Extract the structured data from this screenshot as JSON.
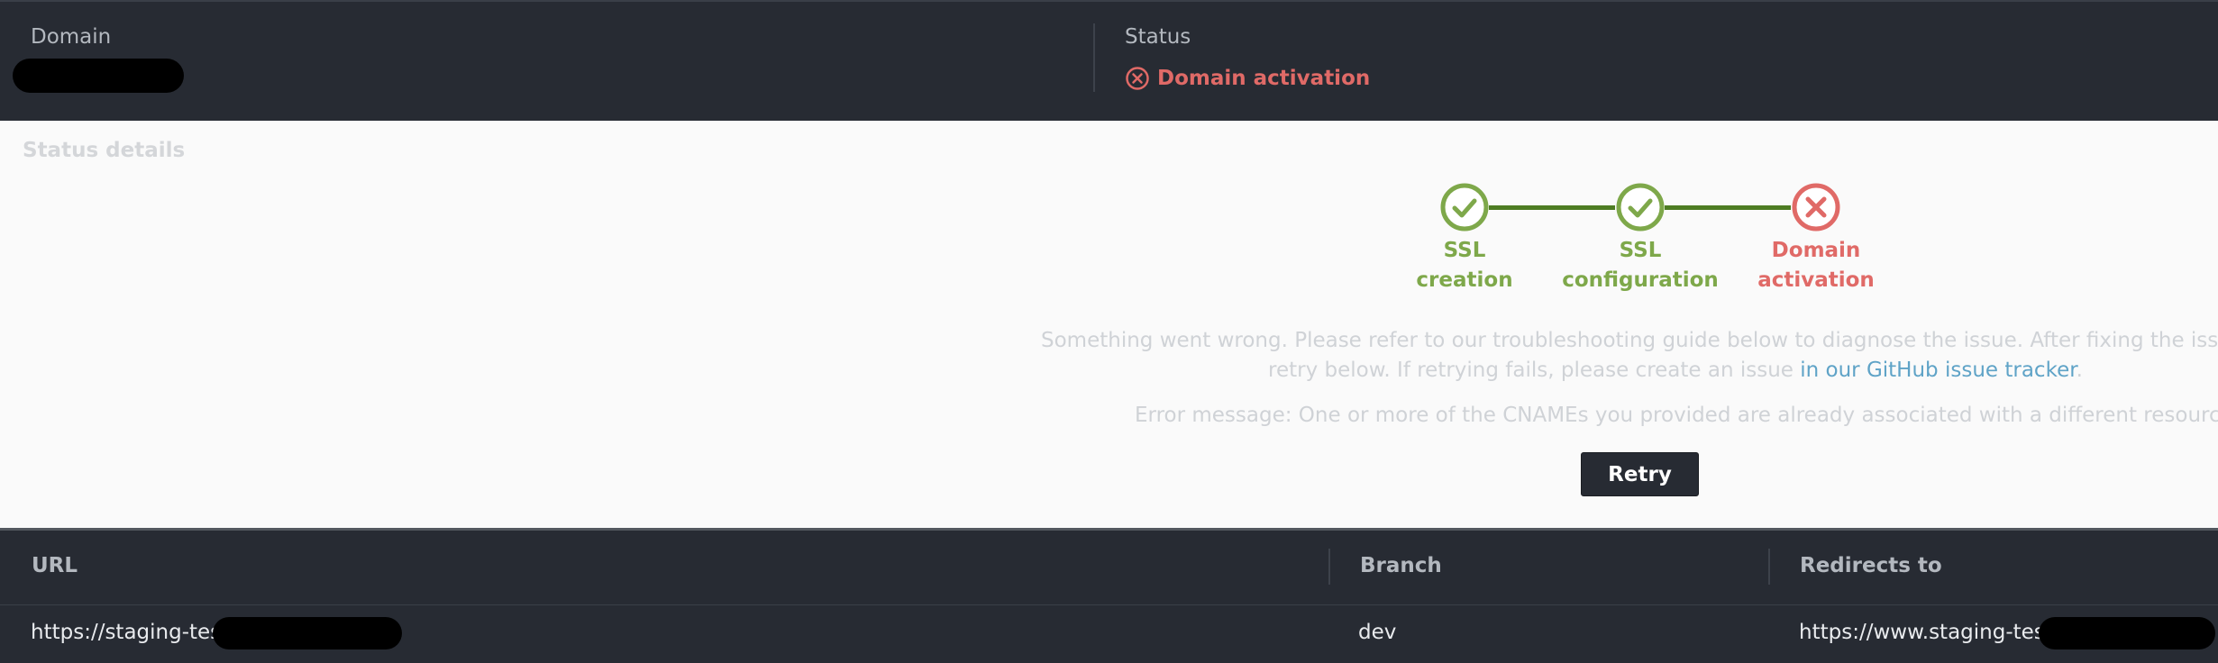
{
  "header": {
    "domain_label": "Domain",
    "status_label": "Status",
    "status_value": "Domain activation",
    "status_icon": "error-circle-icon",
    "status_color": "#e06a67"
  },
  "details": {
    "title": "Status details",
    "steps": [
      {
        "label_line1": "SSL",
        "label_line2": "creation",
        "state": "complete",
        "icon": "check-circle-icon"
      },
      {
        "label_line1": "SSL",
        "label_line2": "configuration",
        "state": "complete",
        "icon": "check-circle-icon"
      },
      {
        "label_line1": "Domain",
        "label_line2": "activation",
        "state": "failed",
        "icon": "x-circle-icon"
      }
    ],
    "message_line1": "Something went wrong. Please refer to our troubleshooting guide below to diagnose the issue. After fixing the issue, choos",
    "message_line2_prefix": "retry below. If retrying fails, please create an issue ",
    "message_link": "in our GitHub issue tracker",
    "message_line2_suffix": ".",
    "error_message": "Error message: One or more of the CNAMEs you provided are already associated with a different resource.",
    "retry_label": "Retry"
  },
  "table": {
    "columns": [
      "URL",
      "Branch",
      "Redirects to"
    ],
    "rows": [
      {
        "url": "https://staging-tes",
        "branch": "dev",
        "redirects_to": "https://www.staging-tes"
      }
    ]
  },
  "colors": {
    "success": "#7ea84a",
    "error": "#e06a67",
    "dark": "#272b33",
    "link": "#5fa3c7"
  }
}
